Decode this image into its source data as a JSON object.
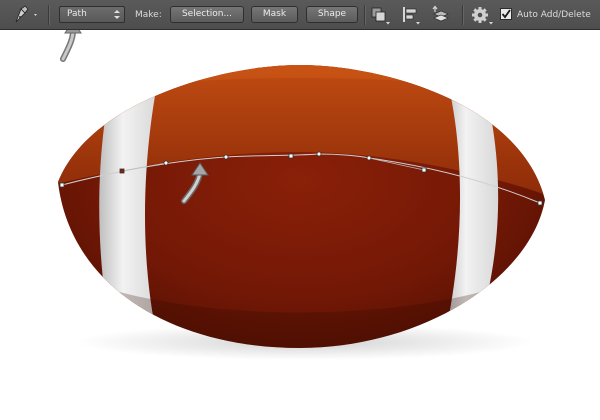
{
  "toolbar": {
    "tool_icon": "pen-tool-icon",
    "mode_select": {
      "selected": "Path"
    },
    "make_label": "Make:",
    "selection_button": "Selection...",
    "mask_button": "Mask",
    "shape_button": "Shape",
    "path_operations_icon": "path-operations-icon",
    "path_alignment_icon": "path-alignment-icon",
    "path_arrangement_icon": "path-arrangement-icon",
    "settings_icon": "gear-icon",
    "auto_add_delete": {
      "label": "Auto Add/Delete",
      "checked": true
    }
  },
  "canvas": {
    "subject": "football-illustration",
    "colors": {
      "leather": "#7a1a06",
      "leather_top": "#b5420c",
      "stripe": "#e6e6e6",
      "path_line": "#c8c8c8"
    },
    "annotations": [
      "arrow-icon",
      "arrow-icon"
    ]
  }
}
